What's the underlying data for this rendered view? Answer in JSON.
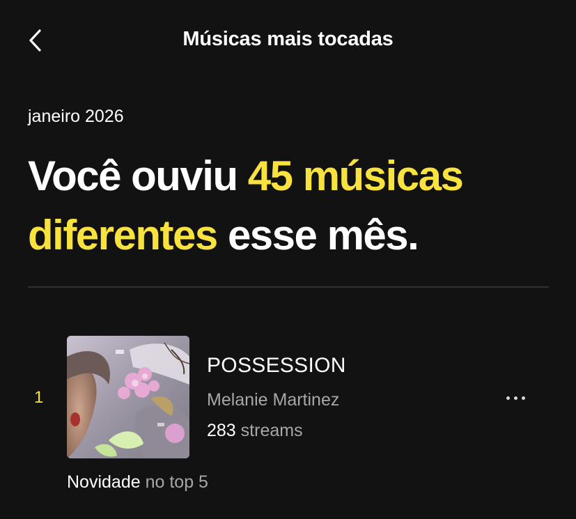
{
  "header": {
    "title": "Músicas mais tocadas",
    "back_icon": "chevron-left-icon"
  },
  "summary": {
    "period": "janeiro 2026",
    "headline_prefix": "Você ouviu",
    "headline_highlight_1": "45 músicas",
    "headline_highlight_2": "diferentes",
    "headline_suffix": "esse mês."
  },
  "colors": {
    "background": "#121212",
    "accent": "#f7e240",
    "muted_text": "#a7a7a7",
    "divider": "#333333"
  },
  "tracks": [
    {
      "rank": "1",
      "title": "POSSESSION",
      "artist": "Melanie Martinez",
      "streams_count": "283",
      "streams_label": "streams",
      "badge_strong": "Novidade",
      "badge_muted": "no top 5",
      "more_icon": "more-horizontal-icon"
    }
  ]
}
